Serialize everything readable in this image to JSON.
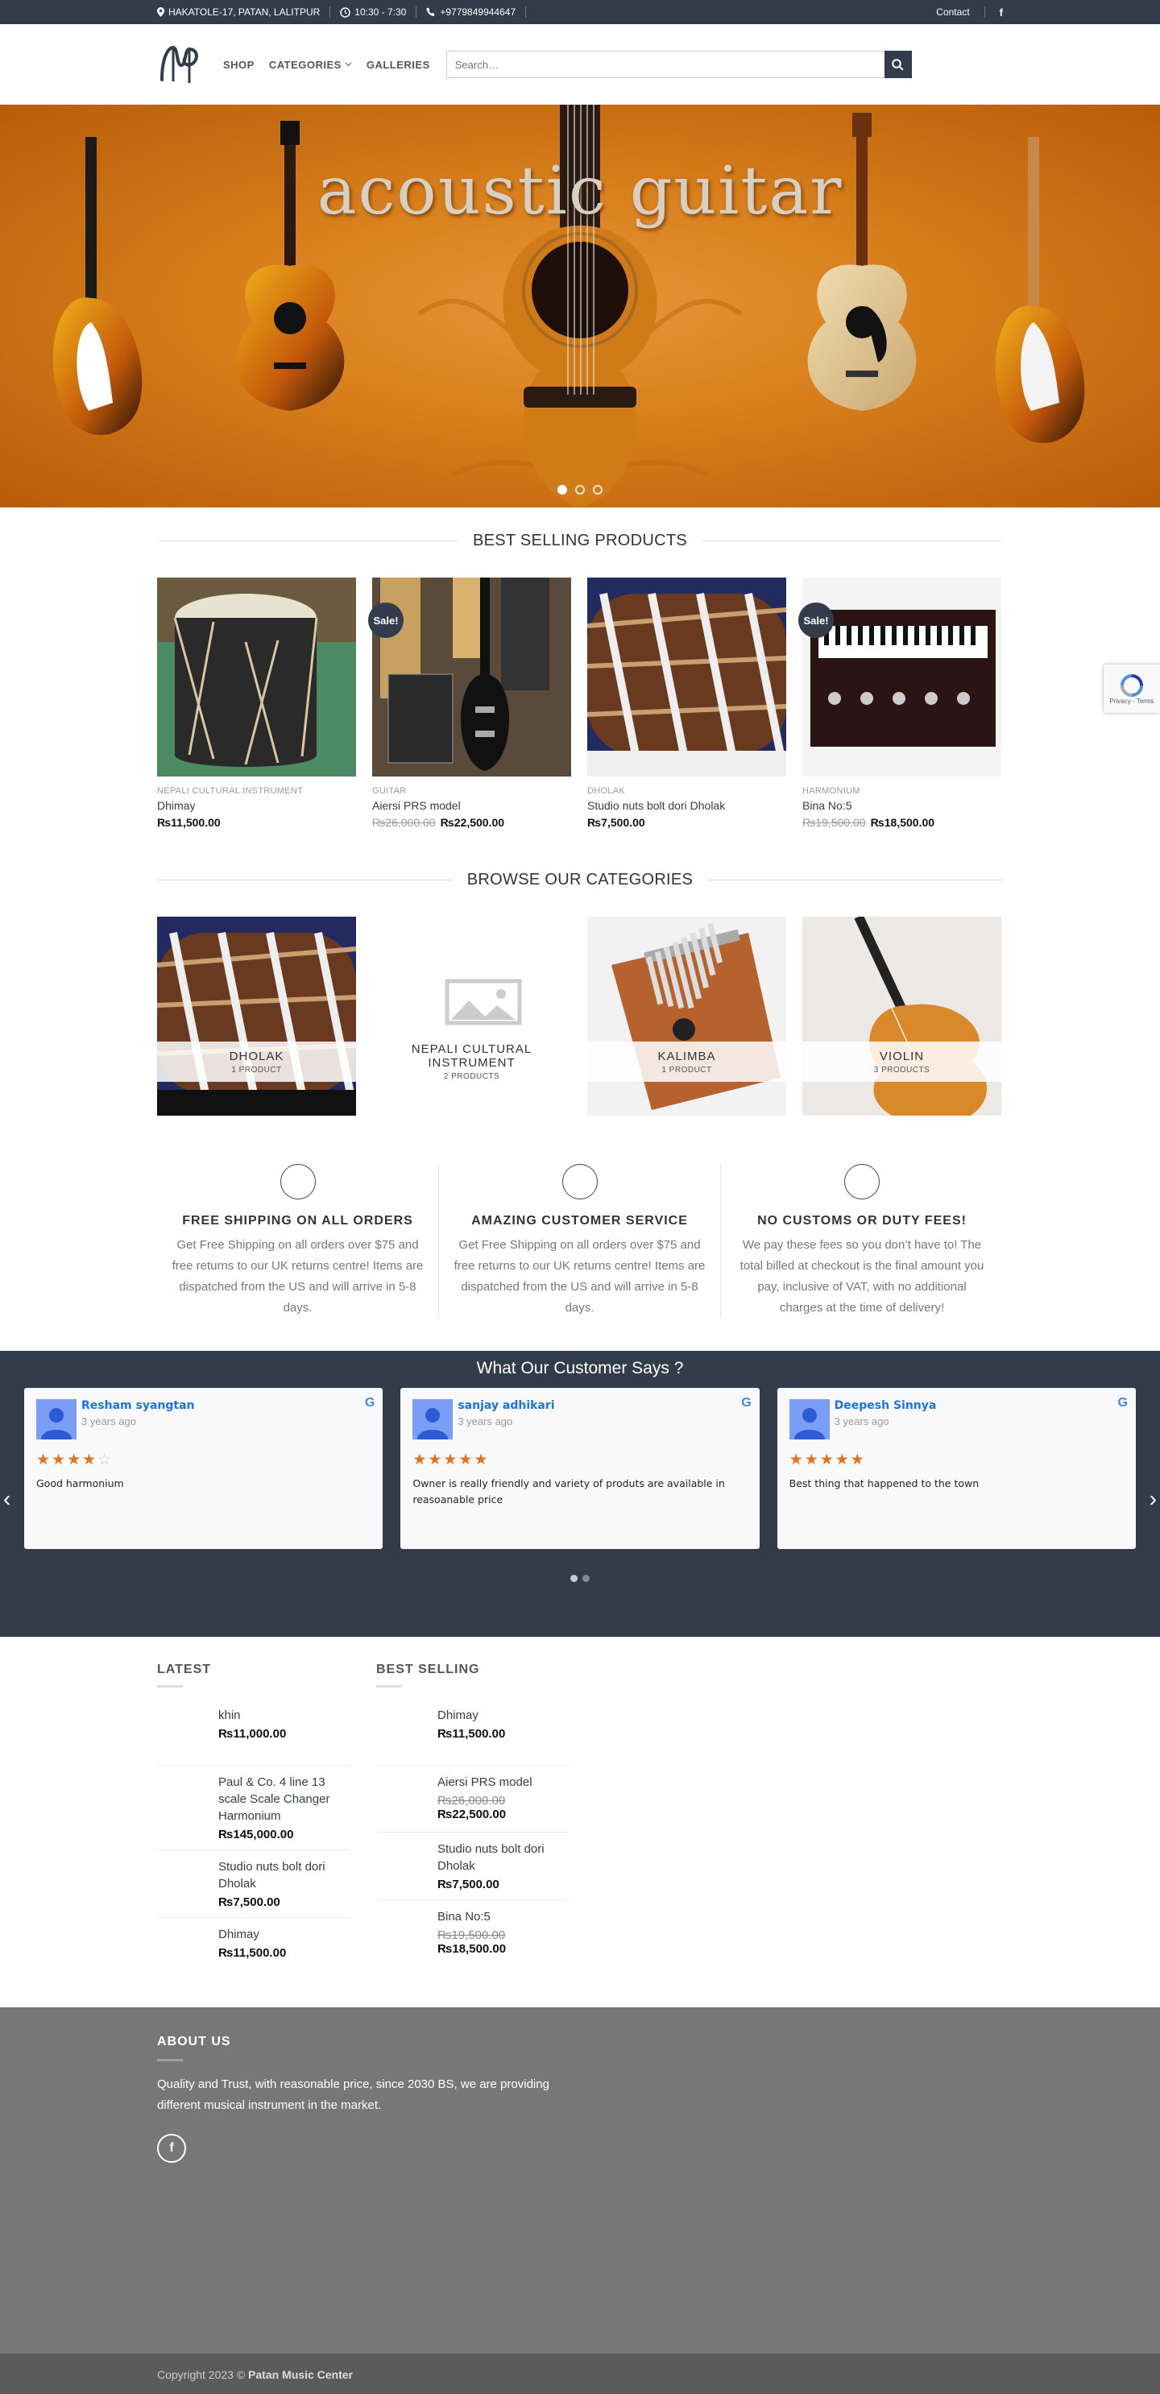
{
  "topbar": {
    "address": "HAKATOLE-17, PATAN, LALITPUR",
    "hours": "10:30 - 7:30",
    "phone": "+9779849944647",
    "contact": "Contact",
    "facebook": "f"
  },
  "nav": {
    "shop": "SHOP",
    "categories": "CATEGORIES",
    "galleries": "GALLERIES",
    "search_placeholder": "Search…"
  },
  "hero": {
    "title": "acoustic guitar",
    "slide_count": 3,
    "active_slide": 1
  },
  "best_selling": {
    "title": "BEST SELLING PRODUCTS",
    "products": [
      {
        "category": "NEPALI CULTURAL INSTRUMENT",
        "name": "Dhimay",
        "price": "₨11,500.00",
        "old_price": "",
        "sale": ""
      },
      {
        "category": "GUITAR",
        "name": "Aiersi PRS model",
        "price": "₨22,500.00",
        "old_price": "₨26,000.00",
        "sale": "Sale!"
      },
      {
        "category": "DHOLAK",
        "name": "Studio nuts bolt dori Dholak",
        "price": "₨7,500.00",
        "old_price": "",
        "sale": ""
      },
      {
        "category": "HARMONIUM",
        "name": "Bina No:5",
        "price": "₨18,500.00",
        "old_price": "₨19,500.00",
        "sale": "Sale!"
      }
    ]
  },
  "browse": {
    "title": "BROWSE OUR CATEGORIES",
    "categories": [
      {
        "name": "DHOLAK",
        "count": "1 PRODUCT"
      },
      {
        "name": "NEPALI CULTURAL INSTRUMENT",
        "count": "2 PRODUCTS"
      },
      {
        "name": "KALIMBA",
        "count": "1 PRODUCT"
      },
      {
        "name": "VIOLIN",
        "count": "3 PRODUCTS"
      }
    ]
  },
  "features": [
    {
      "title": "FREE SHIPPING ON ALL ORDERS",
      "text": "Get Free Shipping on all orders over $75 and free returns to our UK returns centre! Items are dispatched from the US and will arrive in 5-8 days."
    },
    {
      "title": "AMAZING CUSTOMER SERVICE",
      "text": "Get Free Shipping on all orders over $75 and free returns to our UK returns centre! Items are dispatched from the US and will arrive in 5-8 days."
    },
    {
      "title": "NO CUSTOMS OR DUTY FEES!",
      "text": "We pay these fees so you don’t have to! The total billed at checkout is the final amount you pay, inclusive of VAT, with no additional charges at the time of delivery!"
    }
  ],
  "reviews": {
    "title": "What Our Customer Says ?",
    "items": [
      {
        "name": "Resham syangtan",
        "time": "3 years ago",
        "rating": 4,
        "text": "Good harmonium"
      },
      {
        "name": "sanjay adhikari",
        "time": "3 years ago",
        "rating": 5,
        "text": "Owner is really friendly and variety of produts are available in reasoanable price"
      },
      {
        "name": "Deepesh Sinnya",
        "time": "3 years ago",
        "rating": 5,
        "text": "Best thing that happened to the town"
      }
    ]
  },
  "latest": {
    "title": "LATEST",
    "items": [
      {
        "name": "khin",
        "price": "₨11,000.00",
        "old_price": ""
      },
      {
        "name": "Paul & Co. 4 line 13 scale Scale Changer Harmonium",
        "price": "₨145,000.00",
        "old_price": ""
      },
      {
        "name": "Studio nuts bolt dori Dholak",
        "price": "₨7,500.00",
        "old_price": ""
      },
      {
        "name": "Dhimay",
        "price": "₨11,500.00",
        "old_price": ""
      }
    ]
  },
  "best_selling_widget": {
    "title": "BEST SELLING",
    "items": [
      {
        "name": "Dhimay",
        "price": "₨11,500.00",
        "old_price": ""
      },
      {
        "name": "Aiersi PRS model",
        "price": "₨22,500.00",
        "old_price": "₨26,000.00"
      },
      {
        "name": "Studio nuts bolt dori Dholak",
        "price": "₨7,500.00",
        "old_price": ""
      },
      {
        "name": "Bina No:5",
        "price": "₨18,500.00",
        "old_price": "₨19,500.00"
      }
    ]
  },
  "footer": {
    "about_title": "ABOUT US",
    "about_text": "Quality and Trust, with  reasonable price, since 2030 BS, we are providing different musical instrument in the market.",
    "facebook": "f",
    "copyright_prefix": "Copyright 2023 ©",
    "brand": "Patan Music Center"
  },
  "recaptcha": {
    "line": "Privacy - Terms"
  },
  "colors": {
    "dark": "#333c4a",
    "footer": "#777777",
    "accent": "#e7711b",
    "link": "#1a73e8"
  }
}
